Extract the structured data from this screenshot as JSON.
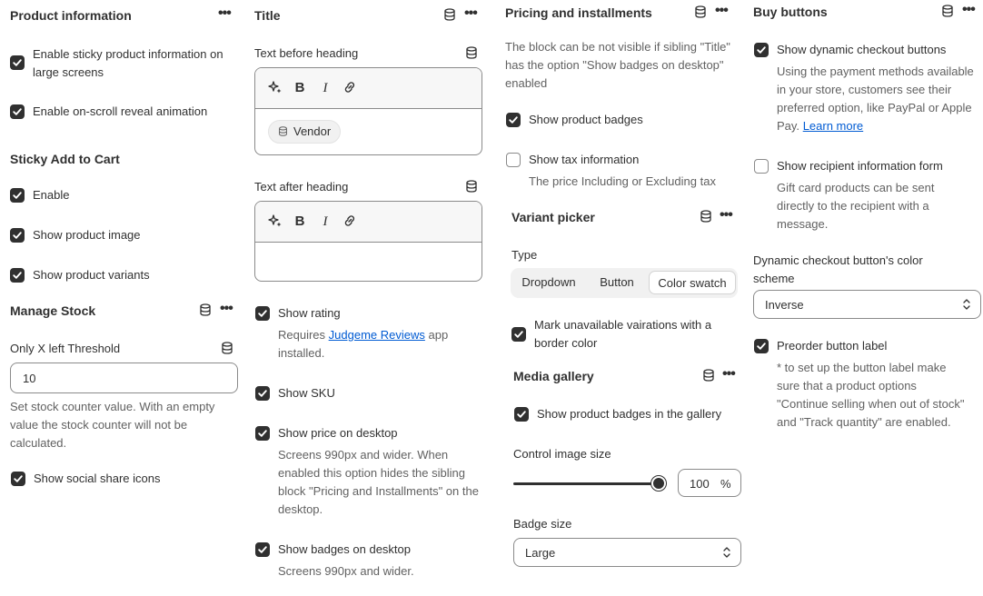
{
  "col1": {
    "product_info": {
      "title": "Product information",
      "opt_sticky": "Enable sticky product information on large screens",
      "opt_reveal": "Enable on-scroll reveal animation"
    },
    "sticky_cart": {
      "title": "Sticky Add to Cart",
      "opt_enable": "Enable",
      "opt_image": "Show product image",
      "opt_variants": "Show product variants"
    },
    "manage_stock": {
      "title": "Manage Stock",
      "threshold_label": "Only X left Threshold",
      "threshold_value": "10",
      "help": "Set stock counter value. With an empty value the stock counter will not be calculated.",
      "opt_share": "Show social share icons"
    }
  },
  "col2": {
    "title": "Title",
    "before_label": "Text before heading",
    "before_chip": "Vendor",
    "after_label": "Text after heading",
    "rating": {
      "label": "Show rating",
      "help_prefix": "Requires",
      "help_link": "Judgeme Reviews",
      "help_suffix": "app installed."
    },
    "sku": "Show SKU",
    "price_desktop": {
      "label": "Show price on desktop",
      "help": "Screens 990px and wider. When enabled this option hides the sibling block \"Pricing and Installments\" on the desktop."
    },
    "badges_desktop": {
      "label": "Show badges on desktop",
      "help": "Screens 990px and wider."
    }
  },
  "col3": {
    "pricing": {
      "title": "Pricing and installments",
      "note": "The block can be not visible if sibling \"Title\" has the option \"Show badges on desktop\" enabled",
      "opt_badges": "Show product badges",
      "opt_tax": "Show tax information",
      "tax_help": "The price Including or Excluding tax"
    },
    "variant": {
      "title": "Variant picker",
      "type_label": "Type",
      "options": [
        "Dropdown",
        "Button",
        "Color swatch"
      ],
      "selected": "Color swatch",
      "opt_unavailable": "Mark unavailable vairations with a border color"
    },
    "media": {
      "title": "Media gallery",
      "opt_badges": "Show product badges in the gallery",
      "size_label": "Control image size",
      "size_value": "100",
      "size_unit": "%",
      "size_level_fraction": 1.0,
      "badge_label": "Badge size",
      "badge_value": "Large"
    }
  },
  "col4": {
    "title": "Buy buttons",
    "dynamic": {
      "label": "Show dynamic checkout buttons",
      "help": "Using the payment methods available in your store, customers see their preferred option, like PayPal or Apple Pay.",
      "link": "Learn more"
    },
    "recipient": {
      "label": "Show recipient information form",
      "help": "Gift card products can be sent directly to the recipient with a message."
    },
    "color_scheme": {
      "label": "Dynamic checkout button's color scheme",
      "value": "Inverse"
    },
    "preorder": {
      "label": "Preorder button label",
      "help": "* to set up the button label make sure that a product options \"Continue selling when out of stock\" and \"Track quantity\" are enabled."
    }
  },
  "icons": {
    "more": "more-horizontal-icon",
    "database": "database-icon",
    "sparkle": "sparkle-icon",
    "bold": "bold-icon",
    "italic": "italic-icon",
    "link": "link-icon",
    "check": "checkmark-icon",
    "select": "select-chevrons-icon"
  },
  "colors": {
    "text": "#303030",
    "muted": "#616161",
    "link": "#005bd3",
    "border": "#8a8a8a"
  }
}
